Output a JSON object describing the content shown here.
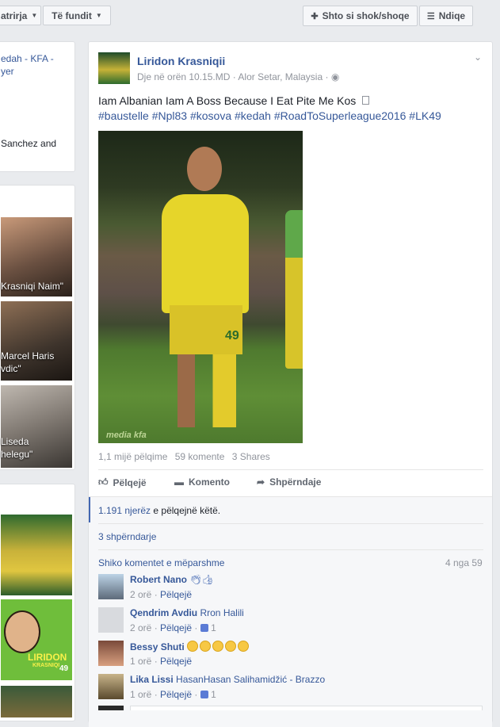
{
  "topbar": {
    "left_btn1": "atrirja",
    "left_btn2": "Të fundit",
    "add_friend": "Shto si shok/shoqe",
    "follow": "Ndiqe"
  },
  "left_card": {
    "line1": "edah - KFA -",
    "line2": "yer",
    "line3": "Sanchez and"
  },
  "photos": [
    {
      "caption": "Krasniqi Naim\""
    },
    {
      "caption_l1": "Marcel Haris",
      "caption_l2": "vdic\""
    },
    {
      "caption_l1": "Liseda",
      "caption_l2": "helegu\""
    }
  ],
  "post": {
    "author": "Liridon Krasniqii",
    "time": "Dje në orën 10.15.MD",
    "location": "Alor Setar, Malaysia",
    "text": "Iam Albanian Iam A Boss Because I Eat Pite Me Kos",
    "hashtags": "#baustelle #Npl83 #kosova #kedah #RoadToSuperleague2016 #LK49",
    "jersey_number": "49",
    "watermark": "media kfa",
    "stats": {
      "likes": "1,1 mijë pëlqime",
      "comments": "59 komente",
      "shares": "3 Shares"
    },
    "actions": {
      "like": "Pëlqejë",
      "comment": "Komento",
      "share": "Shpërndaje"
    }
  },
  "reactions": {
    "like_count_link": "1.191 njerëz",
    "like_count_rest": " e pëlqejnë këtë.",
    "shares": "3 shpërndarje",
    "prev_comments": "Shiko komentet e mëparshme",
    "pager": "4 nga 59"
  },
  "sidebar_art": {
    "label": "LIRIDON",
    "sublabel": "KRASNIQI",
    "number": "49"
  },
  "comments": [
    {
      "name": "Robert Nano",
      "text": "",
      "time": "2 orë",
      "like": "Pëlqejë",
      "count": ""
    },
    {
      "name": "Qendrim Avdiu",
      "text": "Rron Halili",
      "time": "2 orë",
      "like": "Pëlqejë",
      "count": "1"
    },
    {
      "name": "Bessy Shuti",
      "text": "",
      "time": "1 orë",
      "like": "Pëlqejë",
      "count": ""
    },
    {
      "name": "Lika Lissi",
      "text": "HasanHasan Salihamidžić - Brazzo",
      "time": "1 orë",
      "like": "Pëlqejë",
      "count": "1"
    }
  ],
  "sep": " · "
}
